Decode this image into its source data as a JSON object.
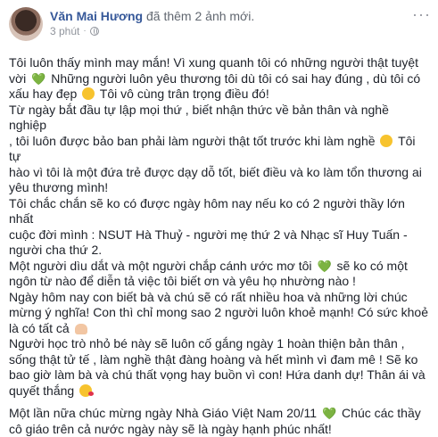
{
  "post": {
    "author": "Văn Mai Hương",
    "action": "đã thêm 2 ảnh mới.",
    "time": "3 phút",
    "more_icon": "···",
    "paragraphs": [
      {
        "lines": [
          [
            "Tôi luôn thấy mình may mắn! Vì xung quanh tôi có những người thật tuyệt"
          ],
          [
            "vời ",
            "{heart}",
            " Những người luôn yêu thương tôi dù tôi có sai hay đúng , dù tôi có"
          ],
          [
            "xấu hay đẹp ",
            "{shy}",
            " Tôi vô cùng trân trọng điều đó!"
          ],
          [
            "Từ ngày bắt đầu tự lập mọi thứ , biết nhận thức về bản thân và nghề nghiệp"
          ],
          [
            ", tôi luôn được bảo ban phải làm người thật tốt trước khi làm nghề ",
            "{smile}",
            " Tôi tự"
          ],
          [
            "hào vì tôi là một đứa trẻ được dạy dỗ tốt, biết điều và ko làm tổn thương ai"
          ],
          [
            "yêu thương mình!"
          ],
          [
            "Tôi chắc chắn sẽ ko có được ngày hôm nay nếu ko có 2 người thầy lớn nhất"
          ],
          [
            "cuộc đời mình : NSUT Hà Thuỷ - người mẹ thứ 2 và Nhạc sĩ Huy Tuấn -"
          ],
          [
            "người cha thứ 2."
          ],
          [
            "Một người dìu dắt và một người chắp cánh ước mơ tôi ",
            "{heart}",
            " sẽ ko có một"
          ],
          [
            "ngôn từ nào để diễn tả việc tôi biết ơn và yêu họ nhường nào !"
          ],
          [
            "Ngày hôm nay con biết bà và chú sẽ có rất nhiều hoa và những lời chúc"
          ],
          [
            "mừng ý nghĩa! Con thì chỉ mong sao 2 người luôn khoẻ mạnh! Có sức khoẻ"
          ],
          [
            "là có tất cả ",
            "{arm}"
          ],
          [
            "Người học trò nhỏ bé này sẽ luôn cố gắng ngày 1 hoàn thiện bản thân ,"
          ],
          [
            "sống thật tử tế , làm nghề thật đàng hoàng và hết mình vì đam mê ! Sẽ ko"
          ],
          [
            "bao giờ làm bà và chú thất vọng hay buồn vì con! Hứa danh dự! Thân ái và"
          ],
          [
            "quyết thắng ",
            "{kiss}"
          ]
        ]
      },
      {
        "lines": [
          [
            "Một lần nữa chúc mừng ngày Nhà Giáo Việt Nam 20/11 ",
            "{heart}",
            " Chúc các thầy"
          ],
          [
            "cô giáo trên cả nước ngày này sẽ là ngày hạnh phúc nhất!"
          ]
        ]
      }
    ],
    "emoji": {
      "heart": "💚",
      "shy": "shy-face-icon",
      "smile": "smile-face-icon",
      "arm": "flexed-arm-icon",
      "kiss": "kiss-face-icon"
    },
    "colors": {
      "author": "#365899",
      "meta": "#90949c",
      "text": "#1d2129",
      "heart": "#2dbd2d"
    }
  }
}
